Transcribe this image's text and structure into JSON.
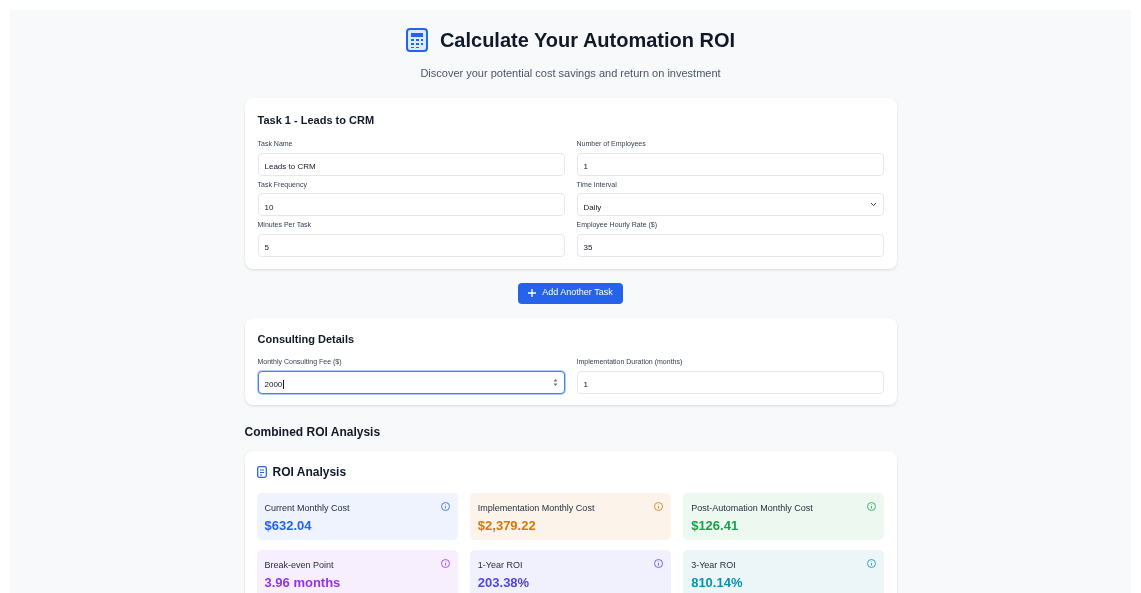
{
  "header": {
    "title": "Calculate Your Automation ROI",
    "subtitle": "Discover your potential cost savings and return on investment"
  },
  "task": {
    "title": "Task 1 - Leads to CRM",
    "fields": [
      {
        "label": "Task Name",
        "value": "Leads to CRM",
        "kind": "input"
      },
      {
        "label": "Number of Employees",
        "value": "1",
        "kind": "input"
      },
      {
        "label": "Task Frequency",
        "value": "10",
        "kind": "input"
      },
      {
        "label": "Time Interval",
        "value": "Daily",
        "kind": "select"
      },
      {
        "label": "Minutes Per Task",
        "value": "5",
        "kind": "input"
      },
      {
        "label": "Employee Hourly Rate ($)",
        "value": "35",
        "kind": "input"
      }
    ]
  },
  "add_button": {
    "label": "Add Another Task"
  },
  "consulting": {
    "title": "Consulting Details",
    "fields": [
      {
        "label": "Monthly Consulting Fee ($)",
        "value": "2000",
        "kind": "number",
        "focused": true
      },
      {
        "label": "Implementation Duration (months)",
        "value": "1",
        "kind": "input",
        "focused": false
      }
    ]
  },
  "combined_heading": "Combined ROI Analysis",
  "roi": {
    "title": "ROI Analysis",
    "cards": [
      {
        "label": "Current Monthly Cost",
        "value": "$632.04",
        "color": "#2563eb"
      },
      {
        "label": "Implementation Monthly Cost",
        "value": "$2,379.22",
        "color": "#d97706"
      },
      {
        "label": "Post-Automation Monthly Cost",
        "value": "$126.41",
        "color": "#16a34a"
      },
      {
        "label": "Break-even Point",
        "value": "3.96 months",
        "color": "#9333ea"
      },
      {
        "label": "1-Year ROI",
        "value": "203.38%",
        "color": "#4f46e5"
      },
      {
        "label": "3-Year ROI",
        "value": "810.14%",
        "color": "#0891b2"
      }
    ]
  }
}
